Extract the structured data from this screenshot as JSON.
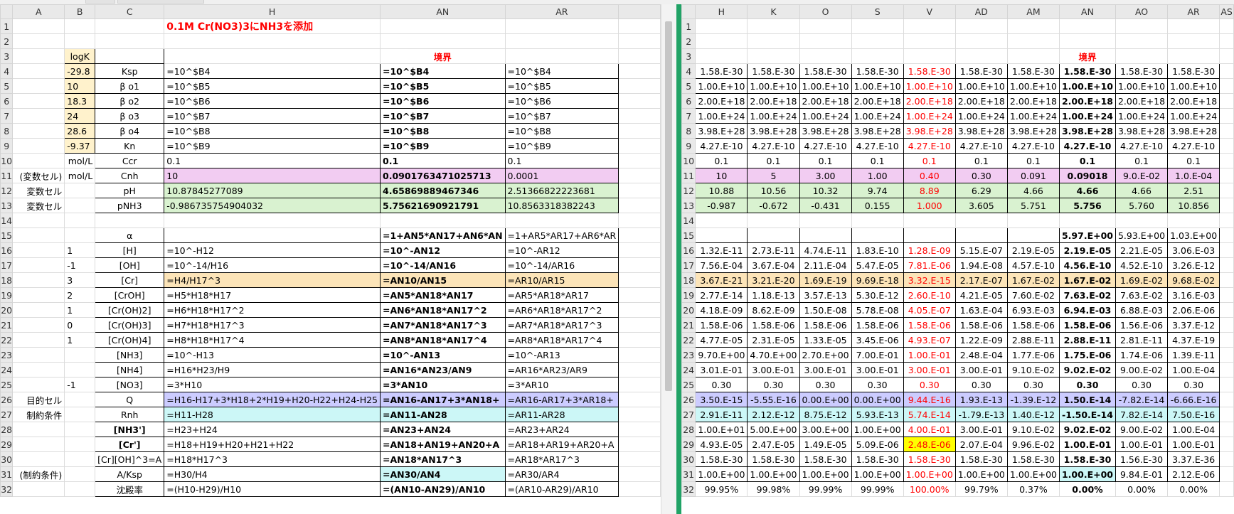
{
  "left": {
    "columns": [
      "A",
      "B",
      "C",
      "H",
      "AN",
      "AR"
    ],
    "title": "0.1M Cr(NO3)3にNH3を添加",
    "boundary_label": "境界",
    "rows": [
      {
        "n": "1",
        "a": "",
        "b": "",
        "c": "",
        "h": "",
        "an": "",
        "ar": ""
      },
      {
        "n": "2",
        "a": "",
        "b": "",
        "c": "",
        "h": "",
        "an": "",
        "ar": ""
      },
      {
        "n": "3",
        "a": "",
        "b": "logK",
        "c": "",
        "h": "",
        "an": "",
        "ar": ""
      },
      {
        "n": "4",
        "a": "",
        "b": "-29.8",
        "c": "Ksp",
        "h": "=10^$B4",
        "an": "=10^$B4",
        "ar": "=10^$B4"
      },
      {
        "n": "5",
        "a": "",
        "b": "10",
        "c": "β o1",
        "h": "=10^$B5",
        "an": "=10^$B5",
        "ar": "=10^$B5"
      },
      {
        "n": "6",
        "a": "",
        "b": "18.3",
        "c": "β o2",
        "h": "=10^$B6",
        "an": "=10^$B6",
        "ar": "=10^$B6"
      },
      {
        "n": "7",
        "a": "",
        "b": "24",
        "c": "β o3",
        "h": "=10^$B7",
        "an": "=10^$B7",
        "ar": "=10^$B7"
      },
      {
        "n": "8",
        "a": "",
        "b": "28.6",
        "c": "β o4",
        "h": "=10^$B8",
        "an": "=10^$B8",
        "ar": "=10^$B8"
      },
      {
        "n": "9",
        "a": "",
        "b": "-9.37",
        "c": "Kn",
        "h": "=10^$B9",
        "an": "=10^$B9",
        "ar": "=10^$B9"
      },
      {
        "n": "10",
        "a": "",
        "b": "mol/L",
        "c": "Ccr",
        "h": "0.1",
        "an": "0.1",
        "ar": "0.1"
      },
      {
        "n": "11",
        "a": "(変数セル)",
        "b": "mol/L",
        "c": "Cnh",
        "h": "10",
        "an": "0.0901763471025713",
        "ar": "0.0001"
      },
      {
        "n": "12",
        "a": "変数セル",
        "b": "",
        "c": "pH",
        "h": "10.87845277089",
        "an": "4.65869889467346",
        "ar": "2.51366822223681"
      },
      {
        "n": "13",
        "a": "変数セル",
        "b": "",
        "c": "pNH3",
        "h": "-0.986735754904032",
        "an": "5.75621690921791",
        "ar": "10.8563318382243"
      },
      {
        "n": "14",
        "a": "",
        "b": "",
        "c": "",
        "h": "",
        "an": "",
        "ar": ""
      },
      {
        "n": "15",
        "a": "",
        "b": "",
        "c": "α",
        "h": "",
        "an": "=1+AN5*AN17+AN6*AN",
        "ar": "=1+AR5*AR17+AR6*AR"
      },
      {
        "n": "16",
        "a": "",
        "b": "1",
        "c": "[H]",
        "h": "=10^-H12",
        "an": "=10^-AN12",
        "ar": "=10^-AR12"
      },
      {
        "n": "17",
        "a": "",
        "b": "-1",
        "c": "[OH]",
        "h": "=10^-14/H16",
        "an": "=10^-14/AN16",
        "ar": "=10^-14/AR16"
      },
      {
        "n": "18",
        "a": "",
        "b": "3",
        "c": "[Cr]",
        "h": "=H4/H17^3",
        "an": "=AN10/AN15",
        "ar": "=AR10/AR15"
      },
      {
        "n": "19",
        "a": "",
        "b": "2",
        "c": "[CrOH]",
        "h": "=H5*H18*H17",
        "an": "=AN5*AN18*AN17",
        "ar": "=AR5*AR18*AR17"
      },
      {
        "n": "20",
        "a": "",
        "b": "1",
        "c": "[Cr(OH)2]",
        "h": "=H6*H18*H17^2",
        "an": "=AN6*AN18*AN17^2",
        "ar": "=AR6*AR18*AR17^2"
      },
      {
        "n": "21",
        "a": "",
        "b": "0",
        "c": "[Cr(OH)3]",
        "h": "=H7*H18*H17^3",
        "an": "=AN7*AN18*AN17^3",
        "ar": "=AR7*AR18*AR17^3"
      },
      {
        "n": "22",
        "a": "",
        "b": "1",
        "c": "[Cr(OH)4]",
        "h": "=H8*H18*H17^4",
        "an": "=AN8*AN18*AN17^4",
        "ar": "=AR8*AR18*AR17^4"
      },
      {
        "n": "23",
        "a": "",
        "b": "",
        "c": "[NH3]",
        "h": "=10^-H13",
        "an": "=10^-AN13",
        "ar": "=10^-AR13"
      },
      {
        "n": "24",
        "a": "",
        "b": "",
        "c": "[NH4]",
        "h": "=H16*H23/H9",
        "an": "=AN16*AN23/AN9",
        "ar": "=AR16*AR23/AR9"
      },
      {
        "n": "25",
        "a": "",
        "b": "-1",
        "c": "[NO3]",
        "h": "=3*H10",
        "an": "=3*AN10",
        "ar": "=3*AR10"
      },
      {
        "n": "26",
        "a": "目的セル",
        "b": "",
        "c": "Q",
        "h": "=H16-H17+3*H18+2*H19+H20-H22+H24-H25",
        "an": "=AN16-AN17+3*AN18+",
        "ar": "=AR16-AR17+3*AR18+"
      },
      {
        "n": "27",
        "a": "制約条件",
        "b": "",
        "c": "Rnh",
        "h": "=H11-H28",
        "an": "=AN11-AN28",
        "ar": "=AR11-AR28"
      },
      {
        "n": "28",
        "a": "",
        "b": "",
        "c": "[NH3']",
        "h": "=H23+H24",
        "an": "=AN23+AN24",
        "ar": "=AR23+AR24"
      },
      {
        "n": "29",
        "a": "",
        "b": "",
        "c": "[Cr']",
        "h": "=H18+H19+H20+H21+H22",
        "an": "=AN18+AN19+AN20+A",
        "ar": "=AR18+AR19+AR20+A"
      },
      {
        "n": "30",
        "a": "",
        "b": "",
        "c": "[Cr][OH]^3=A",
        "h": "=H18*H17^3",
        "an": "=AN18*AN17^3",
        "ar": "=AR18*AR17^3"
      },
      {
        "n": "31",
        "a": "(制約条件)",
        "b": "",
        "c": "A/Ksp",
        "h": "=H30/H4",
        "an": "=AN30/AN4",
        "ar": "=AR30/AR4"
      },
      {
        "n": "32",
        "a": "",
        "b": "",
        "c": "沈殿率",
        "h": "=(H10-H29)/H10",
        "an": "=(AN10-AN29)/AN10",
        "ar": "=(AR10-AR29)/AR10"
      }
    ]
  },
  "right": {
    "columns": [
      "H",
      "K",
      "O",
      "S",
      "V",
      "AD",
      "AM",
      "AN",
      "AO",
      "AR",
      "AS"
    ],
    "boundary_label": "境界",
    "rows": [
      {
        "n": "1",
        "v": [
          "",
          "",
          "",
          "",
          "",
          "",
          "",
          "",
          "",
          ""
        ]
      },
      {
        "n": "2",
        "v": [
          "",
          "",
          "",
          "",
          "",
          "",
          "",
          "",
          "",
          ""
        ]
      },
      {
        "n": "3",
        "v": [
          "",
          "",
          "",
          "",
          "",
          "",
          "",
          "",
          "",
          ""
        ]
      },
      {
        "n": "4",
        "v": [
          "1.58.E-30",
          "1.58.E-30",
          "1.58.E-30",
          "1.58.E-30",
          "1.58.E-30",
          "1.58.E-30",
          "1.58.E-30",
          "1.58.E-30",
          "1.58.E-30",
          "1.58.E-30"
        ]
      },
      {
        "n": "5",
        "v": [
          "1.00.E+10",
          "1.00.E+10",
          "1.00.E+10",
          "1.00.E+10",
          "1.00.E+10",
          "1.00.E+10",
          "1.00.E+10",
          "1.00.E+10",
          "1.00.E+10",
          "1.00.E+10"
        ]
      },
      {
        "n": "6",
        "v": [
          "2.00.E+18",
          "2.00.E+18",
          "2.00.E+18",
          "2.00.E+18",
          "2.00.E+18",
          "2.00.E+18",
          "2.00.E+18",
          "2.00.E+18",
          "2.00.E+18",
          "2.00.E+18"
        ]
      },
      {
        "n": "7",
        "v": [
          "1.00.E+24",
          "1.00.E+24",
          "1.00.E+24",
          "1.00.E+24",
          "1.00.E+24",
          "1.00.E+24",
          "1.00.E+24",
          "1.00.E+24",
          "1.00.E+24",
          "1.00.E+24"
        ]
      },
      {
        "n": "8",
        "v": [
          "3.98.E+28",
          "3.98.E+28",
          "3.98.E+28",
          "3.98.E+28",
          "3.98.E+28",
          "3.98.E+28",
          "3.98.E+28",
          "3.98.E+28",
          "3.98.E+28",
          "3.98.E+28"
        ]
      },
      {
        "n": "9",
        "v": [
          "4.27.E-10",
          "4.27.E-10",
          "4.27.E-10",
          "4.27.E-10",
          "4.27.E-10",
          "4.27.E-10",
          "4.27.E-10",
          "4.27.E-10",
          "4.27.E-10",
          "4.27.E-10"
        ]
      },
      {
        "n": "10",
        "v": [
          "0.1",
          "0.1",
          "0.1",
          "0.1",
          "0.1",
          "0.1",
          "0.1",
          "0.1",
          "0.1",
          "0.1"
        ]
      },
      {
        "n": "11",
        "v": [
          "10",
          "5",
          "3.00",
          "1.00",
          "0.40",
          "0.30",
          "0.091",
          "0.09018",
          "9.0.E-02",
          "1.0.E-04"
        ]
      },
      {
        "n": "12",
        "v": [
          "10.88",
          "10.56",
          "10.32",
          "9.74",
          "8.89",
          "6.29",
          "4.66",
          "4.66",
          "4.66",
          "2.51"
        ]
      },
      {
        "n": "13",
        "v": [
          "-0.987",
          "-0.672",
          "-0.431",
          "0.155",
          "1.000",
          "3.605",
          "5.751",
          "5.756",
          "5.760",
          "10.856"
        ]
      },
      {
        "n": "14",
        "v": [
          "",
          "",
          "",
          "",
          "",
          "",
          "",
          "",
          "",
          ""
        ]
      },
      {
        "n": "15",
        "v": [
          "",
          "",
          "",
          "",
          "",
          "",
          "",
          "5.97.E+00",
          "5.93.E+00",
          "1.03.E+00"
        ]
      },
      {
        "n": "16",
        "v": [
          "1.32.E-11",
          "2.73.E-11",
          "4.74.E-11",
          "1.83.E-10",
          "1.28.E-09",
          "5.15.E-07",
          "2.19.E-05",
          "2.19.E-05",
          "2.21.E-05",
          "3.06.E-03"
        ]
      },
      {
        "n": "17",
        "v": [
          "7.56.E-04",
          "3.67.E-04",
          "2.11.E-04",
          "5.47.E-05",
          "7.81.E-06",
          "1.94.E-08",
          "4.57.E-10",
          "4.56.E-10",
          "4.52.E-10",
          "3.26.E-12"
        ]
      },
      {
        "n": "18",
        "v": [
          "3.67.E-21",
          "3.21.E-20",
          "1.69.E-19",
          "9.69.E-18",
          "3.32.E-15",
          "2.17.E-07",
          "1.67.E-02",
          "1.67.E-02",
          "1.69.E-02",
          "9.68.E-02"
        ]
      },
      {
        "n": "19",
        "v": [
          "2.77.E-14",
          "1.18.E-13",
          "3.57.E-13",
          "5.30.E-12",
          "2.60.E-10",
          "4.21.E-05",
          "7.60.E-02",
          "7.63.E-02",
          "7.63.E-02",
          "3.16.E-03"
        ]
      },
      {
        "n": "20",
        "v": [
          "4.18.E-09",
          "8.62.E-09",
          "1.50.E-08",
          "5.78.E-08",
          "4.05.E-07",
          "1.63.E-04",
          "6.93.E-03",
          "6.94.E-03",
          "6.88.E-03",
          "2.06.E-06"
        ]
      },
      {
        "n": "21",
        "v": [
          "1.58.E-06",
          "1.58.E-06",
          "1.58.E-06",
          "1.58.E-06",
          "1.58.E-06",
          "1.58.E-06",
          "1.58.E-06",
          "1.58.E-06",
          "1.56.E-06",
          "3.37.E-12"
        ]
      },
      {
        "n": "22",
        "v": [
          "4.77.E-05",
          "2.31.E-05",
          "1.33.E-05",
          "3.45.E-06",
          "4.93.E-07",
          "1.22.E-09",
          "2.88.E-11",
          "2.88.E-11",
          "2.81.E-11",
          "4.37.E-19"
        ]
      },
      {
        "n": "23",
        "v": [
          "9.70.E+00",
          "4.70.E+00",
          "2.70.E+00",
          "7.00.E-01",
          "1.00.E-01",
          "2.48.E-04",
          "1.77.E-06",
          "1.75.E-06",
          "1.74.E-06",
          "1.39.E-11"
        ]
      },
      {
        "n": "24",
        "v": [
          "3.01.E-01",
          "3.00.E-01",
          "3.00.E-01",
          "3.00.E-01",
          "3.00.E-01",
          "3.00.E-01",
          "9.10.E-02",
          "9.02.E-02",
          "9.00.E-02",
          "1.00.E-04"
        ]
      },
      {
        "n": "25",
        "v": [
          "0.30",
          "0.30",
          "0.30",
          "0.30",
          "0.30",
          "0.30",
          "0.30",
          "0.30",
          "0.30",
          "0.30"
        ]
      },
      {
        "n": "26",
        "v": [
          "3.50.E-15",
          "-5.55.E-16",
          "0.00.E+00",
          "0.00.E+00",
          "9.44.E-16",
          "1.93.E-13",
          "-1.39.E-12",
          "1.50.E-14",
          "-7.82.E-14",
          "-6.66.E-16"
        ]
      },
      {
        "n": "27",
        "v": [
          "2.91.E-11",
          "2.12.E-12",
          "8.75.E-12",
          "5.93.E-13",
          "5.74.E-14",
          "-1.79.E-13",
          "1.40.E-12",
          "-1.50.E-14",
          "7.82.E-14",
          "7.50.E-16"
        ]
      },
      {
        "n": "28",
        "v": [
          "1.00.E+01",
          "5.00.E+00",
          "3.00.E+00",
          "1.00.E+00",
          "4.00.E-01",
          "3.00.E-01",
          "9.10.E-02",
          "9.02.E-02",
          "9.00.E-02",
          "1.00.E-04"
        ]
      },
      {
        "n": "29",
        "v": [
          "4.93.E-05",
          "2.47.E-05",
          "1.49.E-05",
          "5.09.E-06",
          "2.48.E-06",
          "2.07.E-04",
          "9.96.E-02",
          "1.00.E-01",
          "1.00.E-01",
          "1.00.E-01"
        ]
      },
      {
        "n": "30",
        "v": [
          "1.58.E-30",
          "1.58.E-30",
          "1.58.E-30",
          "1.58.E-30",
          "1.58.E-30",
          "1.58.E-30",
          "1.58.E-30",
          "1.58.E-30",
          "1.56.E-30",
          "3.37.E-36"
        ]
      },
      {
        "n": "31",
        "v": [
          "1.00.E+00",
          "1.00.E+00",
          "1.00.E+00",
          "1.00.E+00",
          "1.00.E+00",
          "1.00.E+00",
          "1.00.E+00",
          "1.00.E+00",
          "9.84.E-01",
          "2.12.E-06"
        ]
      },
      {
        "n": "32",
        "v": [
          "99.95%",
          "99.98%",
          "99.99%",
          "99.99%",
          "100.00%",
          "99.79%",
          "0.37%",
          "0.00%",
          "0.00%",
          "0.00%"
        ]
      }
    ]
  },
  "colors": {
    "yellow": "#fff2cc",
    "pink": "#f2ccf2",
    "green": "#d9f2d0",
    "orange": "#fce4b8",
    "lilac": "#ccccff",
    "cyan": "#ccf7f7",
    "red": "#ff0000",
    "highlight": "#ffff00",
    "splitter": "#21a366"
  }
}
